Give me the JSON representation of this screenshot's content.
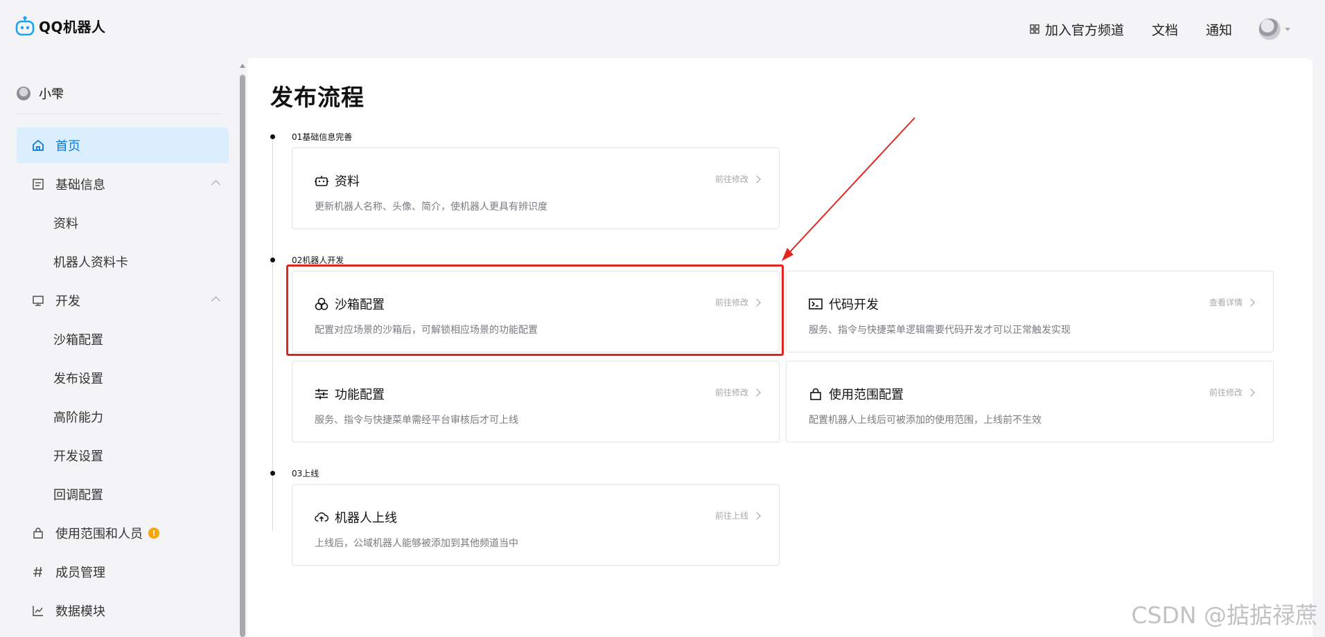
{
  "header": {
    "logo_text": "QQ机器人",
    "nav": {
      "channel": "加入官方频道",
      "docs": "文档",
      "notice": "通知"
    }
  },
  "sidebar": {
    "bot_name": "小雫",
    "items": [
      {
        "label": "首页",
        "icon": "home-icon",
        "active": true
      },
      {
        "label": "基础信息",
        "icon": "document-icon",
        "expanded": true
      },
      {
        "label": "资料",
        "sub": true
      },
      {
        "label": "机器人资料卡",
        "sub": true
      },
      {
        "label": "开发",
        "icon": "monitor-icon",
        "expanded": true
      },
      {
        "label": "沙箱配置",
        "sub": true
      },
      {
        "label": "发布设置",
        "sub": true
      },
      {
        "label": "高阶能力",
        "sub": true
      },
      {
        "label": "开发设置",
        "sub": true
      },
      {
        "label": "回调配置",
        "sub": true
      },
      {
        "label": "使用范围和人员",
        "icon": "bag-icon",
        "badge": "!"
      },
      {
        "label": "成员管理",
        "icon": "hash-icon"
      },
      {
        "label": "数据模块",
        "icon": "chart-icon"
      }
    ]
  },
  "main": {
    "title": "发布流程",
    "steps": [
      {
        "label": "01基础信息完善"
      },
      {
        "label": "02机器人开发"
      },
      {
        "label": "03上线"
      }
    ],
    "cards": {
      "profile": {
        "title": "资料",
        "desc": "更新机器人名称、头像、简介，使机器人更具有辨识度",
        "link": "前往修改"
      },
      "sandbox": {
        "title": "沙箱配置",
        "desc": "配置对应场景的沙箱后，可解锁相应场景的功能配置",
        "link": "前往修改"
      },
      "code": {
        "title": "代码开发",
        "desc": "服务、指令与快捷菜单逻辑需要代码开发才可以正常触发实现",
        "link": "查看详情"
      },
      "feature": {
        "title": "功能配置",
        "desc": "服务、指令与快捷菜单需经平台审核后才可上线",
        "link": "前往修改"
      },
      "scope": {
        "title": "使用范围配置",
        "desc": "配置机器人上线后可被添加的使用范围，上线前不生效",
        "link": "前往修改"
      },
      "online": {
        "title": "机器人上线",
        "desc": "上线后，公域机器人能够被添加到其他频道当中",
        "link": "前往上线"
      }
    }
  },
  "colors": {
    "accent": "#0a78dc",
    "active_bg": "#dbeefd",
    "annotation": "#e2261f",
    "badge": "#f7a600"
  },
  "watermark": "CSDN @掂掂禄蔗"
}
